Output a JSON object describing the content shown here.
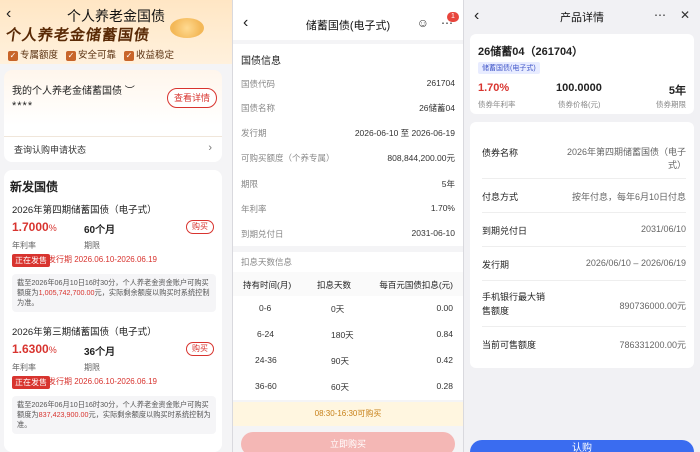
{
  "panel1": {
    "nav_title": "个人养老金国债",
    "hero_title": "个人养老金储蓄国债",
    "hero_tags": [
      "专属额度",
      "安全可靠",
      "收益稳定"
    ],
    "account": {
      "title": "我的个人养老金储蓄国债",
      "masked": "****",
      "view_button": "查看详情",
      "query_row": "查询认购申请状态"
    },
    "section_title": "新发国债",
    "bonds": [
      {
        "name": "2026年第四期储蓄国债（电子式）",
        "rate": "1.7000",
        "rate_unit": "%",
        "period": "60个月",
        "rate_label": "年利率",
        "period_label": "期限",
        "buy_label": "购买",
        "status": "正在发售",
        "issue_label": "发行期",
        "issue_dates": "2026.06.10-2026.06.19",
        "note_prefix": "截至2026年06月10日16时30分，个人养老金资金账户可购买额度为",
        "note_amount": "1,005,742,700.00",
        "note_suffix": "元，实际剩余额度以购买时系统控制为准。"
      },
      {
        "name": "2026年第三期储蓄国债（电子式）",
        "rate": "1.6300",
        "rate_unit": "%",
        "period": "36个月",
        "rate_label": "年利率",
        "period_label": "期限",
        "buy_label": "购买",
        "status": "正在发售",
        "issue_label": "发行期",
        "issue_dates": "2026.06.10-2026.06.19",
        "note_prefix": "截至2026年06月10日16时30分，个人养老金资金账户可购买额度为",
        "note_amount": "837,423,900.00",
        "note_suffix": "元，实际剩余额度以购买时系统控制为准。"
      }
    ]
  },
  "panel2": {
    "nav_title": "储蓄国债(电子式)",
    "badge_count": "1",
    "info_head": "国债信息",
    "rows": [
      {
        "label": "国债代码",
        "value": "261704"
      },
      {
        "label": "国债名称",
        "value": "26储蓄04"
      },
      {
        "label": "发行期",
        "value": "2026-06-10 至 2026-06-19"
      },
      {
        "label": "可购买额度（个养专属）",
        "value": "808,844,200.00元"
      },
      {
        "label": "期限",
        "value": "5年"
      },
      {
        "label": "年利率",
        "value": "1.70%"
      },
      {
        "label": "到期兑付日",
        "value": "2031-06-10"
      }
    ],
    "deduct_head": "扣息天数信息",
    "table_header": [
      "持有时间(月)",
      "扣息天数",
      "每百元国债扣息(元)"
    ],
    "table_rows": [
      [
        "0-6",
        "0天",
        "0.00"
      ],
      [
        "6-24",
        "180天",
        "0.84"
      ],
      [
        "24-36",
        "90天",
        "0.42"
      ],
      [
        "36-60",
        "60天",
        "0.28"
      ]
    ],
    "hours": "08:30-16:30可购买",
    "buy_now": "立即购买"
  },
  "panel3": {
    "nav_title": "产品详情",
    "product_title": "26储蓄04（261704）",
    "tag": "储蓄国债(电子式)",
    "summary": [
      {
        "value": "1.70%",
        "label": "债券年利率"
      },
      {
        "value": "100.0000",
        "label": "债券价格(元)"
      },
      {
        "value": "5年",
        "label": "债券期限"
      }
    ],
    "details": [
      {
        "label": "债券名称",
        "value": "2026年第四期储蓄国债（电子式）"
      },
      {
        "label": "付息方式",
        "value": "按年付息，每年6月10日付息"
      },
      {
        "label": "到期兑付日",
        "value": "2031/06/10"
      },
      {
        "label": "发行期",
        "value": "2026/06/10 – 2026/06/19"
      },
      {
        "label": "手机银行最大销售额度",
        "value": "890736000.00元"
      },
      {
        "label": "当前可售额度",
        "value": "786331200.00元"
      }
    ],
    "bottom_button": "认购"
  },
  "colors": {
    "accent_red": "#d8342f",
    "accent_blue": "#3a6cf0",
    "accent_orange": "#c7811a"
  }
}
